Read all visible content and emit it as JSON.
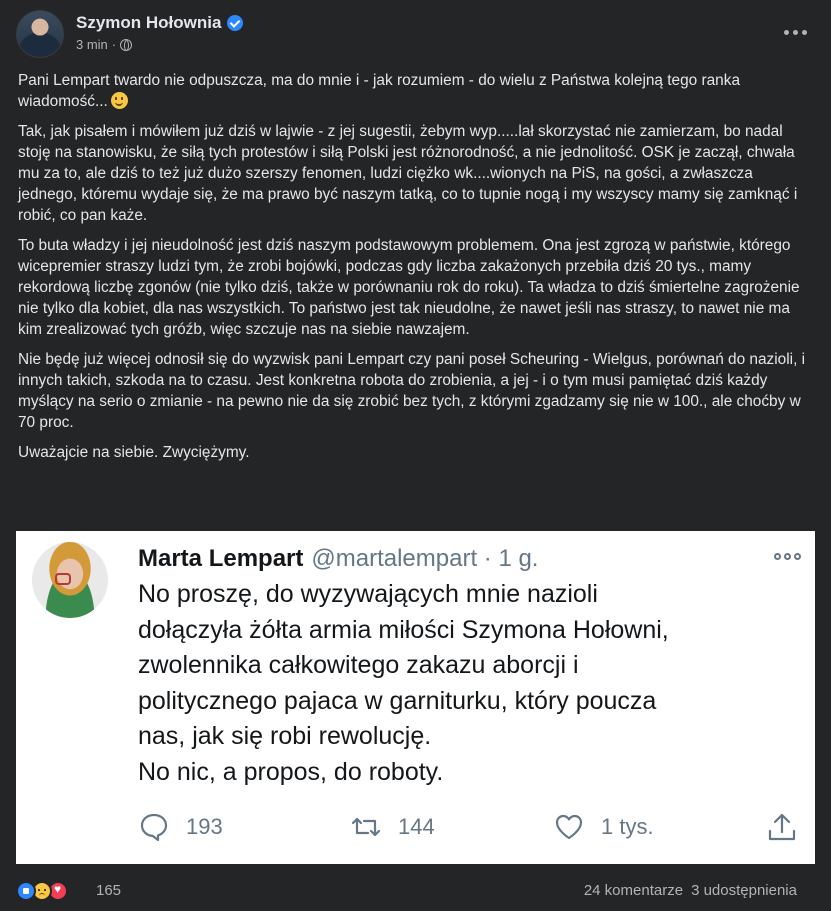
{
  "post": {
    "author": "Szymon Hołownia",
    "time": "3 min",
    "separator": "·",
    "paragraphs": [
      "Pani Lempart twardo nie odpuszcza, ma do mnie i - jak rozumiem - do wielu z Państwa kolejną tego ranka wiadomość...",
      "Tak, jak pisałem i mówiłem już dziś w lajwie - z jej sugestii, żebym wyp.....lał skorzystać nie zamierzam, bo nadal stoję na stanowisku, że siłą tych protestów i siłą Polski jest różnorodność, a nie jednolitość. OSK je zaczął, chwała mu za to, ale dziś to też już dużo szerszy fenomen, ludzi ciężko wk....wionych na PiS, na gości, a zwłaszcza jednego, któremu wydaje się, że ma prawo być naszym tatką, co to tupnie nogą i my wszyscy mamy się zamknąć i robić, co pan każe.",
      "To buta władzy i jej nieudolność jest dziś naszym podstawowym problemem. Ona jest zgrozą w państwie, którego wicepremier straszy ludzi tym, że zrobi bojówki, podczas gdy liczba zakażonych przebiła dziś 20 tys., mamy rekordową liczbę zgonów (nie tylko dziś, także w porównaniu rok do roku). Ta władza to dziś śmiertelne zagrożenie nie tylko dla kobiet, dla nas wszystkich. To państwo jest tak nieudolne, że nawet jeśli nas straszy, to nawet nie ma kim zrealizować tych gróźb, więc szczuje nas na siebie nawzajem.",
      "Nie będę już więcej odnosił się do wyzwisk pani Lempart czy pani poseł Scheuring - Wielgus, porównań do nazioli, i innych takich, szkoda na to czasu. Jest konkretna robota do zrobienia, a jej - i o tym musi pamiętać dziś każdy myślący na serio o zmianie -  na pewno nie da się zrobić bez tych, z którymi zgadzamy się nie w 100., ale choćby w 70 proc.",
      "Uważajcie na siebie. Zwyciężymy."
    ]
  },
  "tweet": {
    "name": "Marta Lempart",
    "handle": "@martalempart · 1 g.",
    "body_lines": [
      "No proszę, do wyzywających mnie nazioli",
      "dołączyła żółta armia miłości Szymona Hołowni,",
      "zwolennika całkowitego zakazu aborcji i",
      "politycznego pajaca w garniturku, który poucza",
      "nas, jak się robi rewolucję.",
      "No nic, a propos, do roboty."
    ],
    "replies": "193",
    "retweets": "144",
    "likes": "1 tys."
  },
  "footer": {
    "reactions_count": "165",
    "comments": "24 komentarze",
    "shares": "3 udostępnienia"
  },
  "colors": {
    "page_bg": "#242526",
    "text": "#e4e6eb",
    "secondary": "#b0b3b8",
    "verified": "#2d88ff",
    "tweet_bg": "#ffffff",
    "tweet_secondary": "#657786"
  },
  "icons": [
    "verified-badge-icon",
    "globe-icon",
    "more-options-icon",
    "smile-emoji-icon",
    "reply-icon",
    "retweet-icon",
    "like-heart-icon",
    "share-icon",
    "like-reaction-icon",
    "sad-reaction-icon",
    "love-reaction-icon"
  ]
}
